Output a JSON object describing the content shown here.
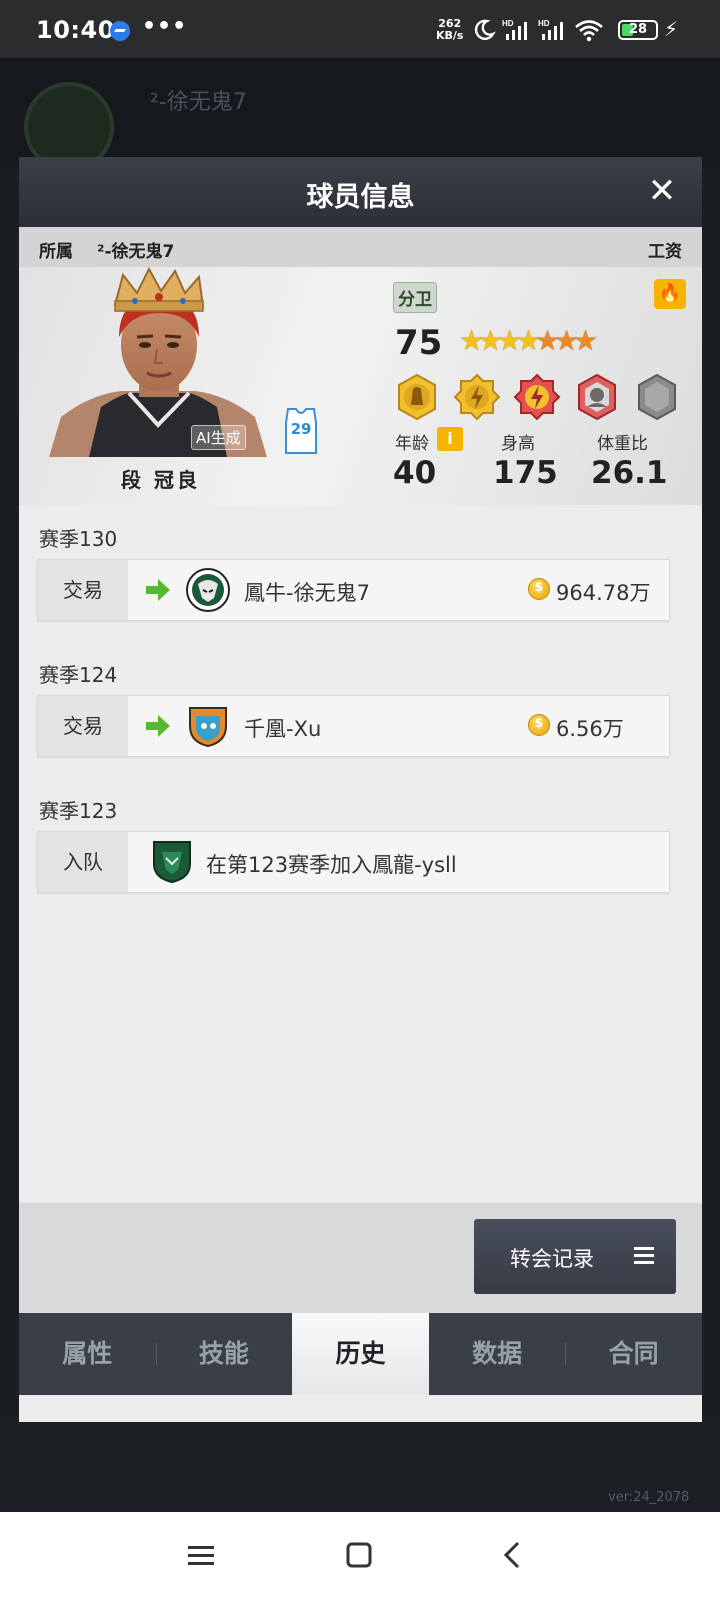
{
  "status_bar": {
    "time": "10:40",
    "dots": "•••",
    "net_speed_value": "262",
    "net_speed_unit": "KB/s",
    "battery": "28"
  },
  "background": {
    "team_name": "²-徐无鬼7",
    "version": "ver:24_2078"
  },
  "modal": {
    "title": "球员信息",
    "close_label": "✕",
    "affiliation_label": "所属",
    "affiliation_team": "²-徐无鬼7",
    "salary_label": "工资"
  },
  "player": {
    "name": "段 冠良",
    "ai_badge": "AI生成",
    "jersey_number": "29",
    "position": "分卫",
    "rating": "75",
    "star_count": 7,
    "star_colors": [
      "#f2c21a",
      "#f2c21a",
      "#f2c21a",
      "#f2c21a",
      "#ec8a2a",
      "#ec8a2a",
      "#ec8a2a"
    ],
    "age_label": "年龄",
    "age": "40",
    "height_label": "身高",
    "height": "175",
    "weight_ratio_label": "体重比",
    "weight_ratio": "26.1",
    "badges": [
      "gold-player-badge",
      "gold-lightning-badge",
      "red-lightning-badge",
      "red-head-badge",
      "gray-locked-badge"
    ]
  },
  "history": [
    {
      "season": "赛季130",
      "type": "交易",
      "team": "鳳牛-徐无鬼7",
      "amount": "964.78万",
      "logo": "bull-logo"
    },
    {
      "season": "赛季124",
      "type": "交易",
      "team": "千凰-Xu",
      "amount": "6.56万",
      "logo": "shield-logo"
    },
    {
      "season": "赛季123",
      "type": "入队",
      "text": "在第123赛季加入鳳龍-ysll",
      "logo": "dragon-logo"
    }
  ],
  "transfer_button": {
    "label": "转会记录"
  },
  "tabs": [
    {
      "label": "属性",
      "active": false
    },
    {
      "label": "技能",
      "active": false
    },
    {
      "label": "历史",
      "active": true
    },
    {
      "label": "数据",
      "active": false
    },
    {
      "label": "合同",
      "active": false
    }
  ],
  "colors": {
    "header": "#2f333b",
    "accent_gold": "#f6b400",
    "arrow_green": "#55b82e",
    "jersey_blue": "#2a8ad8"
  }
}
